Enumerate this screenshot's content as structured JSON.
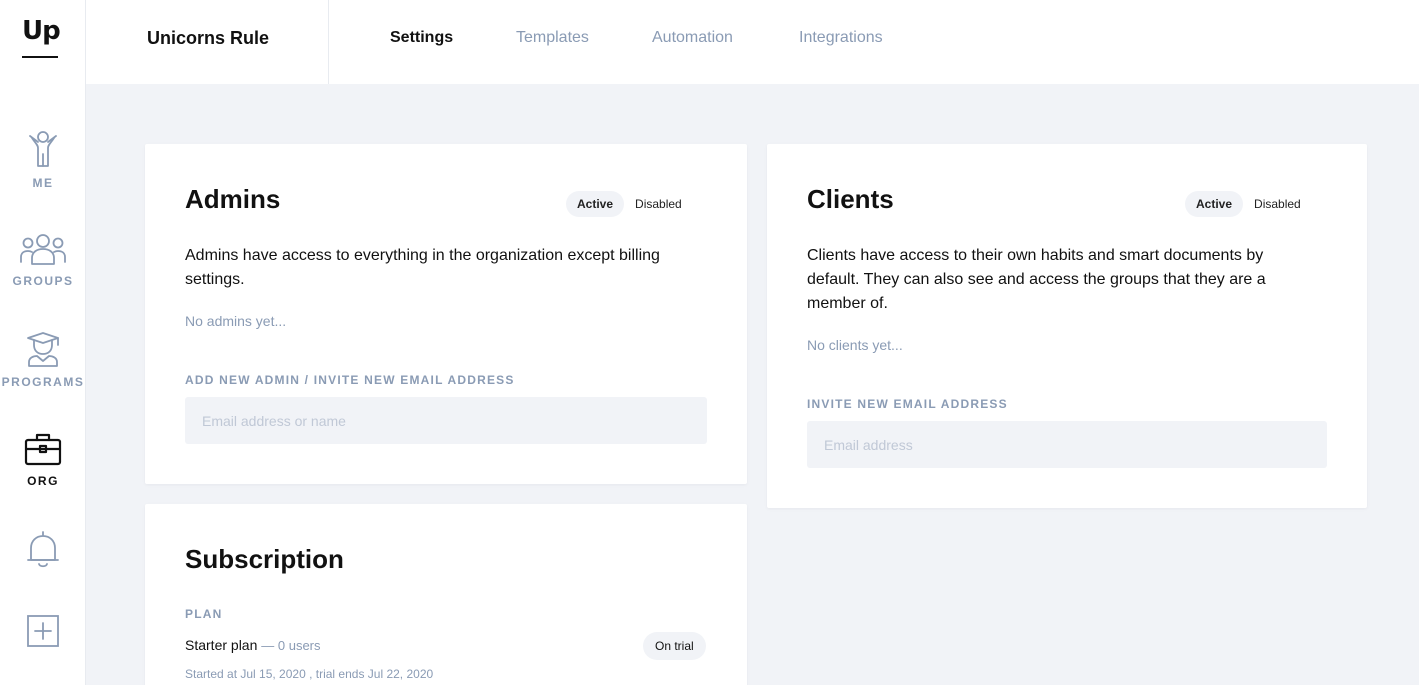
{
  "sidebar": {
    "logo": "Up",
    "items": [
      {
        "label": "ME",
        "icon": "person-icon"
      },
      {
        "label": "GROUPS",
        "icon": "group-icon"
      },
      {
        "label": "PROGRAMS",
        "icon": "graduate-icon"
      },
      {
        "label": "ORG",
        "icon": "briefcase-icon",
        "active": true
      },
      {
        "label": "",
        "icon": "bell-icon"
      },
      {
        "label": "",
        "icon": "plus-square-icon"
      }
    ]
  },
  "header": {
    "org_name": "Unicorns Rule",
    "tabs": [
      {
        "label": "Settings",
        "active": true
      },
      {
        "label": "Templates"
      },
      {
        "label": "Automation"
      },
      {
        "label": "Integrations"
      }
    ]
  },
  "admins": {
    "title": "Admins",
    "toggle_active": "Active",
    "toggle_disabled": "Disabled",
    "description": "Admins have access to everything in the organization except billing settings.",
    "empty": "No admins yet...",
    "field_label": "ADD NEW ADMIN / INVITE NEW EMAIL ADDRESS",
    "placeholder": "Email address or name"
  },
  "clients": {
    "title": "Clients",
    "toggle_active": "Active",
    "toggle_disabled": "Disabled",
    "description": "Clients have access to their own habits and smart documents by default. They can also see and access the groups that they are a member of.",
    "empty": "No clients yet...",
    "field_label": "INVITE NEW EMAIL ADDRESS",
    "placeholder": "Email address"
  },
  "subscription": {
    "title": "Subscription",
    "plan_label": "PLAN",
    "plan_name": "Starter plan",
    "plan_users": "— 0 users",
    "status": "On trial",
    "dates": "Started at Jul 15, 2020 , trial ends Jul 22, 2020"
  },
  "colors": {
    "background": "#f1f3f7",
    "muted": "#8a9bb4",
    "text": "#111111"
  }
}
